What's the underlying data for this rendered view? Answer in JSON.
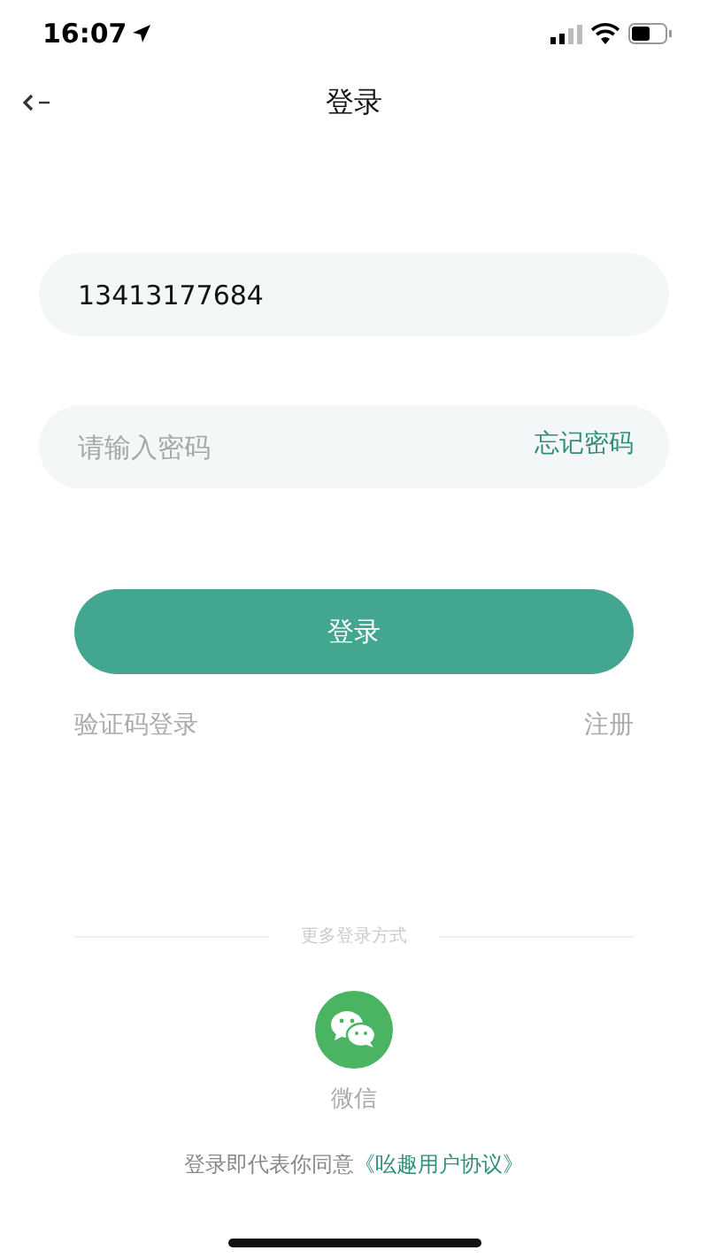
{
  "status_bar": {
    "time": "16:07"
  },
  "nav": {
    "title": "登录"
  },
  "phone_field": {
    "value": "13413177684"
  },
  "password_field": {
    "placeholder": "请输入密码",
    "forgot_link": "忘记密码"
  },
  "login_button": "登录",
  "links": {
    "sms_login": "验证码登录",
    "register": "注册"
  },
  "more_methods": {
    "label": "更多登录方式",
    "options": [
      {
        "kind": "wechat",
        "label": "微信"
      }
    ]
  },
  "agreement": {
    "text": "登录即代表你同意",
    "link": "《吆趣用户协议》"
  }
}
